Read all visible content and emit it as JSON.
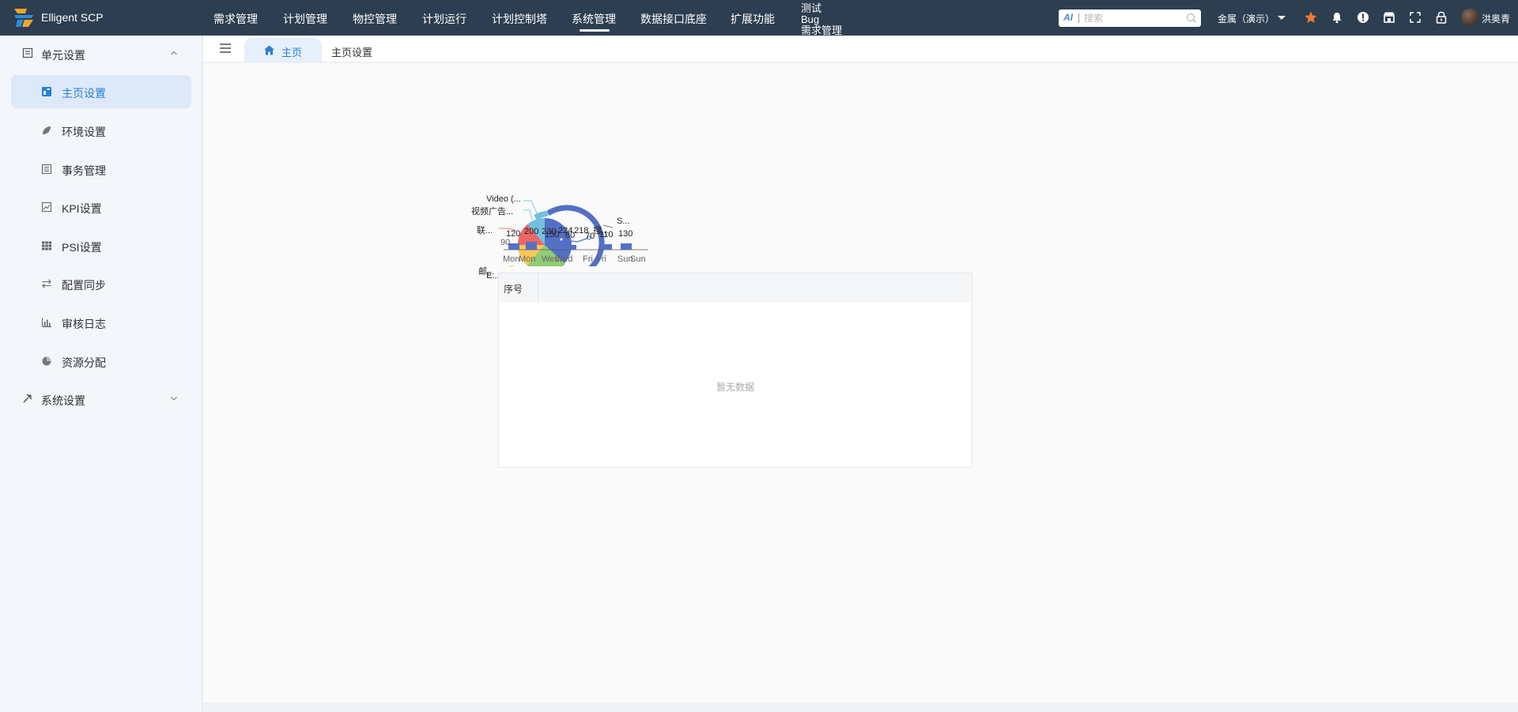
{
  "app": {
    "title": "Elligent SCP"
  },
  "nav": {
    "items": [
      "需求管理",
      "计划管理",
      "物控管理",
      "计划运行",
      "计划控制塔",
      "系统管理",
      "数据接口底座",
      "扩展功能"
    ],
    "active": "系统管理",
    "multi": [
      "测试",
      "Bug",
      "需求管理"
    ]
  },
  "search": {
    "ai_label": "AI",
    "placeholder": "搜索"
  },
  "header": {
    "company": "金属（演示）",
    "username": "洪奥青"
  },
  "colors": {
    "topbar": "#2c3e50",
    "accent": "#2a7fd4",
    "star": "#f07b2e",
    "active_bg": "#dde9f8"
  },
  "sidebar": {
    "groups": [
      {
        "label": "单元设置",
        "icon": "unit-settings-icon",
        "expanded": true
      },
      {
        "label": "系统设置",
        "icon": "tools-icon",
        "expanded": false
      }
    ],
    "items": [
      {
        "label": "主页设置",
        "icon": "home-page-icon",
        "active": true
      },
      {
        "label": "环境设置",
        "icon": "leaf-icon"
      },
      {
        "label": "事务管理",
        "icon": "list-icon"
      },
      {
        "label": "KPI设置",
        "icon": "line-chart-icon"
      },
      {
        "label": "PSI设置",
        "icon": "grid-icon"
      },
      {
        "label": "配置同步",
        "icon": "sync-arrows-icon"
      },
      {
        "label": "审核日志",
        "icon": "bar-chart-icon"
      },
      {
        "label": "资源分配",
        "icon": "pie-icon"
      }
    ]
  },
  "tabs": {
    "home": "主页",
    "current": "主页设置"
  },
  "chart_overlay": {
    "pie_labels": [
      "Video (...",
      "视频广告...",
      "联...",
      "邮...",
      "E...",
      "S...",
      "搜..."
    ],
    "value_labels": [
      "120",
      "200",
      "150",
      "80",
      "70",
      "110",
      "130",
      "90"
    ],
    "stacked_labels": [
      "230",
      "224",
      "218"
    ],
    "axis_labels": [
      "Mon",
      "Mon",
      "Wed",
      "Wed",
      "Fri",
      "Fri",
      "Sun",
      "Sun"
    ]
  },
  "table": {
    "columns": [
      "序号"
    ],
    "empty": "暂无数据"
  }
}
